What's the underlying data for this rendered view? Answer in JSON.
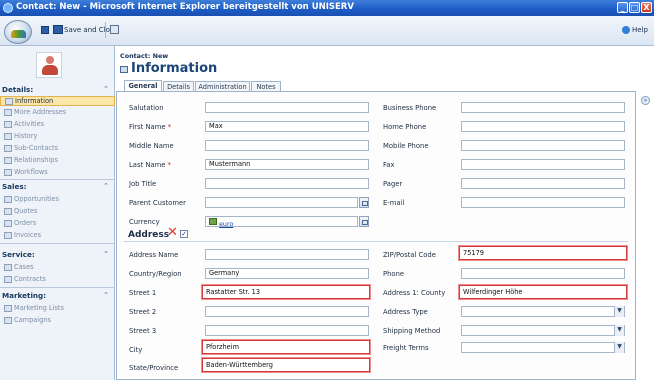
{
  "window": {
    "title": "Contact: New - Microsoft Internet Explorer bereitgestellt von UNISERV",
    "controls": [
      "_",
      "□",
      "X"
    ]
  },
  "toolbar": {
    "save_close_label": "Save and Close",
    "help_label": "Help"
  },
  "nav": {
    "sections": [
      {
        "label": "Details:",
        "items": [
          "Information",
          "More Addresses",
          "Activities",
          "History",
          "Sub-Contacts",
          "Relationships",
          "Workflows"
        ]
      },
      {
        "label": "Sales:",
        "items": [
          "Opportunities",
          "Quotes",
          "Orders",
          "Invoices"
        ]
      },
      {
        "label": "Service:",
        "items": [
          "Cases",
          "Contracts"
        ]
      },
      {
        "label": "Marketing:",
        "items": [
          "Marketing Lists",
          "Campaigns"
        ]
      }
    ],
    "collapse_glyph": "»"
  },
  "header": {
    "breadcrumb": "Contact: New",
    "title": "Information"
  },
  "tabs": [
    "General",
    "Details",
    "Administration",
    "Notes"
  ],
  "form": {
    "left": [
      {
        "label": "Salutation",
        "value": ""
      },
      {
        "label": "First Name",
        "required": "*",
        "value": "Max"
      },
      {
        "label": "Middle Name",
        "value": ""
      },
      {
        "label": "Last Name",
        "required": "*",
        "value": "Mustermann"
      },
      {
        "label": "Job Title",
        "value": ""
      },
      {
        "label": "Parent Customer",
        "value": ""
      },
      {
        "label": "Currency",
        "value": "euro"
      }
    ],
    "right": [
      {
        "label": "Business Phone",
        "value": ""
      },
      {
        "label": "Home Phone",
        "value": ""
      },
      {
        "label": "Mobile Phone",
        "value": ""
      },
      {
        "label": "Fax",
        "value": ""
      },
      {
        "label": "Pager",
        "value": ""
      },
      {
        "label": "E-mail",
        "value": ""
      }
    ],
    "address_title": "Address",
    "address_left": [
      {
        "label": "Address Name",
        "value": ""
      },
      {
        "label": "Country/Region",
        "value": "Germany"
      },
      {
        "label": "Street 1",
        "value": "Rastatter Str. 13"
      },
      {
        "label": "Street 2",
        "value": ""
      },
      {
        "label": "Street 3",
        "value": ""
      },
      {
        "label": "City",
        "value": "Pforzheim"
      },
      {
        "label": "State/Province",
        "value": "Baden-Württemberg"
      }
    ],
    "address_right": [
      {
        "label": "ZIP/Postal Code",
        "value": "75179"
      },
      {
        "label": "Phone",
        "value": ""
      },
      {
        "label": "Address 1: County",
        "value": "Wilferdinger Höhe"
      },
      {
        "label": "Address Type",
        "value": ""
      },
      {
        "label": "Shipping Method",
        "value": ""
      },
      {
        "label": "Freight Terms",
        "value": ""
      }
    ],
    "dropdown_glyph": "▼",
    "check_glyph": "✓",
    "delete_glyph": "✕"
  },
  "colors": {
    "title_bar": "#1d5bc4",
    "highlight": "#d43a3a",
    "accent": "#1b4478"
  }
}
